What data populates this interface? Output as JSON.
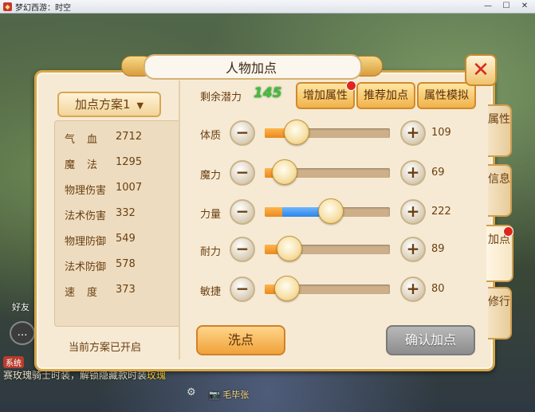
{
  "window": {
    "title": "梦幻西游：时空",
    "min": "—",
    "max": "☐",
    "close": "✕"
  },
  "scene": {
    "friends": "好友",
    "chat_icon": "speech-bubble-icon",
    "system_tag": "系统",
    "marquee_before": "赛玫瑰骑士时装，解锁隐藏款时装",
    "marquee_highlight": "玫瑰",
    "bottom_name": "毛毕张"
  },
  "panel": {
    "title": "人物加点",
    "plan_selector": "加点方案1",
    "plan_status": "当前方案已开启",
    "potential_label": "剩余潜力",
    "potential_value": "145",
    "buttons": {
      "add_attr": "增加属性",
      "recommend": "推荐加点",
      "simulate": "属性模拟",
      "wash": "洗点",
      "confirm": "确认加点"
    },
    "stats": [
      {
        "label": "气血",
        "value": "2712"
      },
      {
        "label": "魔法",
        "value": "1295"
      },
      {
        "label": "物理伤害",
        "value": "1007"
      },
      {
        "label": "法术伤害",
        "value": "332"
      },
      {
        "label": "物理防御",
        "value": "549"
      },
      {
        "label": "法术防御",
        "value": "578"
      },
      {
        "label": "速度",
        "value": "373"
      }
    ],
    "attributes": [
      {
        "label": "体质",
        "value": "109",
        "base_fraction": 0.25,
        "added_fraction": 0
      },
      {
        "label": "魔力",
        "value": "69",
        "base_fraction": 0.15,
        "added_fraction": 0
      },
      {
        "label": "力量",
        "value": "222",
        "base_fraction": 0.14,
        "added_fraction": 0.38
      },
      {
        "label": "耐力",
        "value": "89",
        "base_fraction": 0.19,
        "added_fraction": 0
      },
      {
        "label": "敏捷",
        "value": "80",
        "base_fraction": 0.17,
        "added_fraction": 0
      }
    ],
    "side_tabs": [
      "属性",
      "信息",
      "加点",
      "修行"
    ]
  },
  "colors": {
    "orange_fill": "#e88a1e",
    "blue_fill": "#2b86e8",
    "potential_green": "#3fbf3a",
    "badge_red": "#e0261b"
  }
}
